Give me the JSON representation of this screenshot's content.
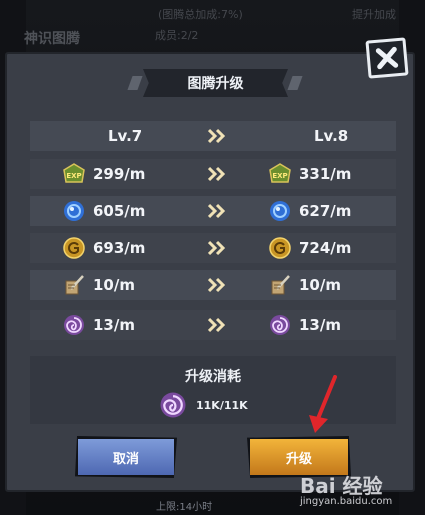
{
  "background": {
    "top_note": "(图腾总加成:7%)",
    "members": "成员:2/2",
    "upgrade_bonus_button": "提升加成",
    "section_title": "神识图腾",
    "bottom_note": "上限:14小时"
  },
  "dialog": {
    "title": "图腾升级",
    "levels": {
      "from": "Lv.7",
      "to": "Lv.8"
    },
    "stats": [
      {
        "icon": "exp-icon",
        "from": "299/m",
        "to": "331/m"
      },
      {
        "icon": "blue-orb-icon",
        "from": "605/m",
        "to": "627/m"
      },
      {
        "icon": "gold-coin-icon",
        "from": "693/m",
        "to": "724/m"
      },
      {
        "icon": "scroll-quill-icon",
        "from": "10/m",
        "to": "10/m"
      },
      {
        "icon": "purple-swirl-icon",
        "from": "13/m",
        "to": "13/m"
      }
    ],
    "cost": {
      "title": "升级消耗",
      "icon": "purple-swirl-icon",
      "value": "11K/11K"
    },
    "buttons": {
      "cancel": "取消",
      "confirm": "升级"
    }
  },
  "watermark": {
    "brand": "Bai 经验",
    "url": "jingyan.baidu.com"
  },
  "colors": {
    "dialog_bg": "#3a3e47",
    "cancel_btn": "#6482c6",
    "confirm_btn": "#e09a2c",
    "arrow_accent": "#f0e2b6",
    "annotation_arrow": "#e0262b"
  }
}
